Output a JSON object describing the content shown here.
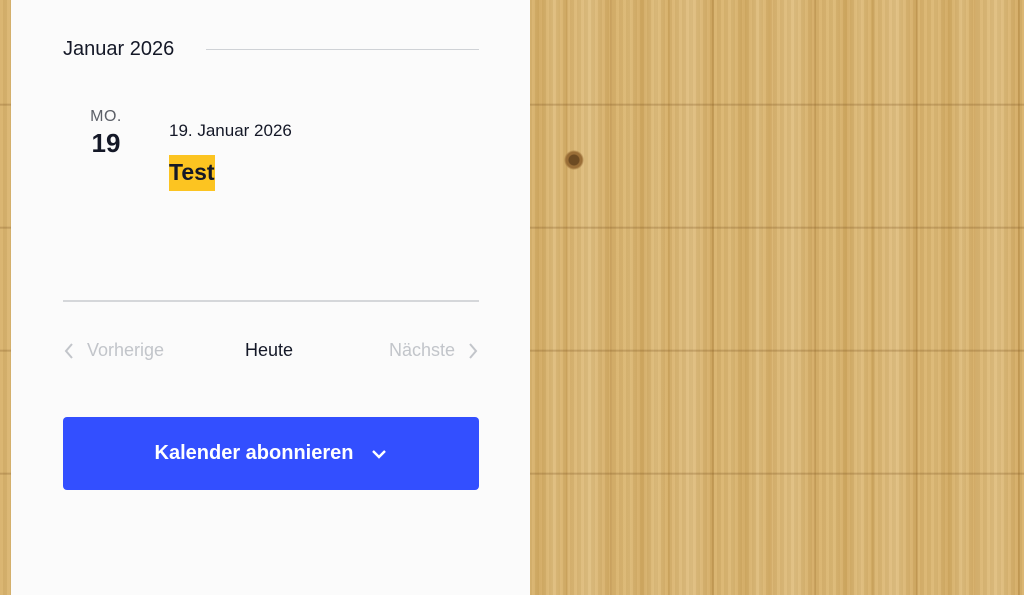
{
  "calendar": {
    "month_heading": "Januar 2026",
    "event": {
      "day_of_week": "MO.",
      "day_number": "19",
      "date_text": "19. Januar 2026",
      "title": "Test",
      "title_highlight_color": "#fcc421"
    },
    "nav": {
      "previous_label": "Vorherige",
      "today_label": "Heute",
      "next_label": "Nächste",
      "previous_icon": "chevron-left-icon",
      "next_icon": "chevron-right-icon"
    },
    "subscribe": {
      "label": "Kalender abonnieren",
      "icon": "chevron-down-icon",
      "color": "#334fff"
    }
  },
  "colors": {
    "panel_background": "#fbfbfb",
    "text_primary": "#141827",
    "text_disabled": "#c2c5ca",
    "background": "wood-texture"
  }
}
